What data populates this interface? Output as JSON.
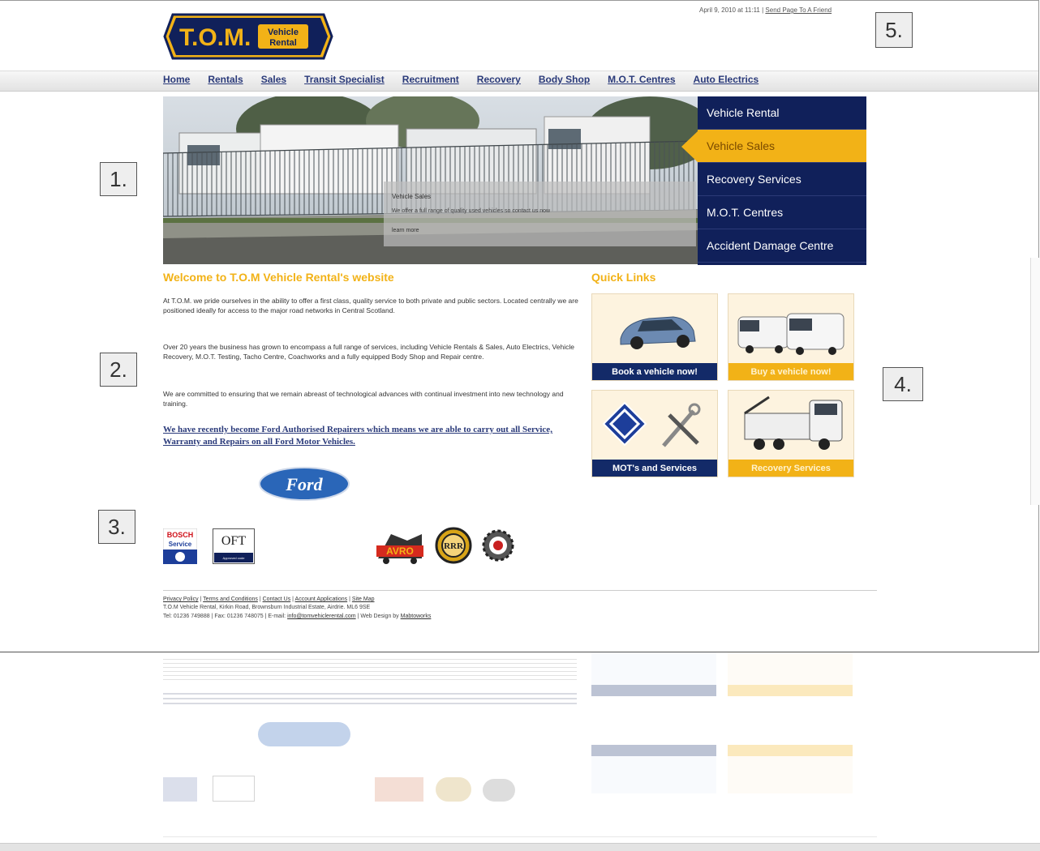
{
  "header": {
    "logo_main": "T.O.M.",
    "logo_sub1": "Vehicle",
    "logo_sub2": "Rental",
    "date": "April 9, 2010 at 11:11 |",
    "send_link": "Send Page To A Friend"
  },
  "nav": [
    "Home",
    "Rentals",
    "Sales",
    "Transit Specialist",
    "Recruitment",
    "Recovery",
    "Body Shop",
    "M.O.T. Centres",
    "Auto Electrics"
  ],
  "hero": {
    "caption_title": "Vehicle Sales",
    "caption_text": "We offer a full range of quality used vehicles so contact us now",
    "caption_more": "learn more",
    "menu": [
      "Vehicle Rental",
      "Vehicle Sales",
      "Recovery Services",
      "M.O.T. Centres",
      "Accident Damage Centre"
    ],
    "active_index": 1
  },
  "welcome": {
    "title": "Welcome to T.O.M Vehicle Rental's website",
    "p1": "At T.O.M. we pride ourselves in the ability to offer a first class, quality service to both private and public sectors. Located centrally we are positioned ideally for access to the major road networks in Central Scotland.",
    "p2": "Over 20 years the business has grown to encompass a full range of services, including Vehicle Rentals & Sales, Auto Electrics, Vehicle Recovery, M.O.T. Testing, Tacho Centre, Coachworks and a fully equipped Body Shop and Repair centre.",
    "p3": "We are committed to ensuring that we remain abreast of technological advances with continual investment into new technology and training.",
    "ford_link": "We have recently become Ford Authorised Repairers which means we are able to carry out all Service, Warranty and Repairs on all Ford Motor Vehicles."
  },
  "quick_links": {
    "title": "Quick Links",
    "tiles": [
      "Book a vehicle now!",
      "Buy a vehicle now!",
      "MOT's and Services",
      "Recovery Services"
    ]
  },
  "logos": {
    "ford": "Ford",
    "bosch1": "BOSCH",
    "bosch2": "Service",
    "oft": "OFT",
    "oft_sub": "Approved code",
    "avro": "AVRO",
    "rrr": "RRR"
  },
  "footer": {
    "links": [
      "Privacy Policy",
      "Terms and Conditions",
      "Contact Us",
      "Account Applications",
      "Site Map"
    ],
    "address": "T.O.M Vehicle Rental, Kirkin Road, Brownsburn Industrial Estate, Airdrie. ML6 9SE",
    "phone": "Tel: 01236 749888 | Fax: 01236 748075 | E-mail:",
    "email": "info@tomvehiclerental.com",
    "design_pre": "| Web Design by",
    "design": "Mabtoworks"
  },
  "callouts": [
    "1.",
    "2.",
    "3.",
    "4.",
    "5."
  ],
  "colors": {
    "navy": "#10205a",
    "gold": "#f2b217",
    "tile_bg": "#fdf3df"
  }
}
